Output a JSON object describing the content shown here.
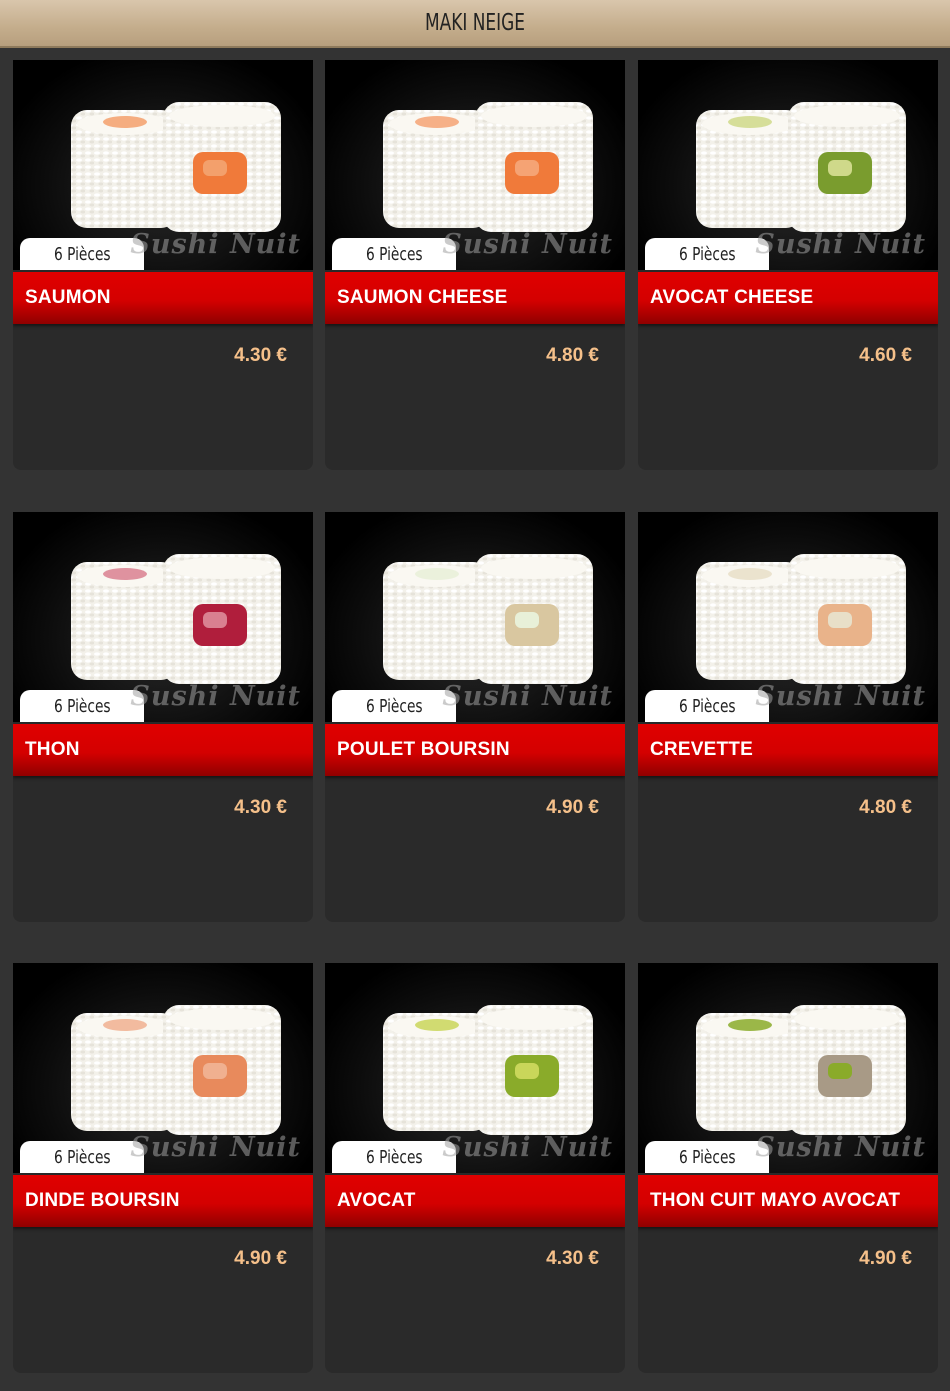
{
  "header": {
    "title": "MAKI NEIGE"
  },
  "products": [
    {
      "name": "SAUMON",
      "pieces": "6 Pièces",
      "price": "4.30 €",
      "brand": "Sushi Nuit",
      "fill": "#f07a3a",
      "fill2": "#f3a06c"
    },
    {
      "name": "SAUMON CHEESE",
      "pieces": "6 Pièces",
      "price": "4.80 €",
      "brand": "Sushi Nuit",
      "fill": "#f07a3a",
      "fill2": "#f5a374"
    },
    {
      "name": "AVOCAT CHEESE",
      "pieces": "6 Pièces",
      "price": "4.60 €",
      "brand": "Sushi Nuit",
      "fill": "#7a9c2e",
      "fill2": "#cfd98a"
    },
    {
      "name": "THON",
      "pieces": "6 Pièces",
      "price": "4.30 €",
      "brand": "Sushi Nuit",
      "fill": "#b01e3c",
      "fill2": "#d98090"
    },
    {
      "name": "POULET BOURSIN",
      "pieces": "6 Pièces",
      "price": "4.90 €",
      "brand": "Sushi Nuit",
      "fill": "#d9c7a0",
      "fill2": "#e8f0d8"
    },
    {
      "name": "CREVETTE",
      "pieces": "6 Pièces",
      "price": "4.80 €",
      "brand": "Sushi Nuit",
      "fill": "#e9b38a",
      "fill2": "#e8dfc8"
    },
    {
      "name": "DINDE BOURSIN",
      "pieces": "6 Pièces",
      "price": "4.90 €",
      "brand": "Sushi Nuit",
      "fill": "#e88a5c",
      "fill2": "#f0b090"
    },
    {
      "name": "AVOCAT",
      "pieces": "6 Pièces",
      "price": "4.30 €",
      "brand": "Sushi Nuit",
      "fill": "#8aab2a",
      "fill2": "#c9d65a"
    },
    {
      "name": "THON CUIT MAYO AVOCAT",
      "pieces": "6 Pièces",
      "price": "4.90 €",
      "brand": "Sushi Nuit",
      "fill": "#a89a86",
      "fill2": "#8aab2a"
    }
  ]
}
